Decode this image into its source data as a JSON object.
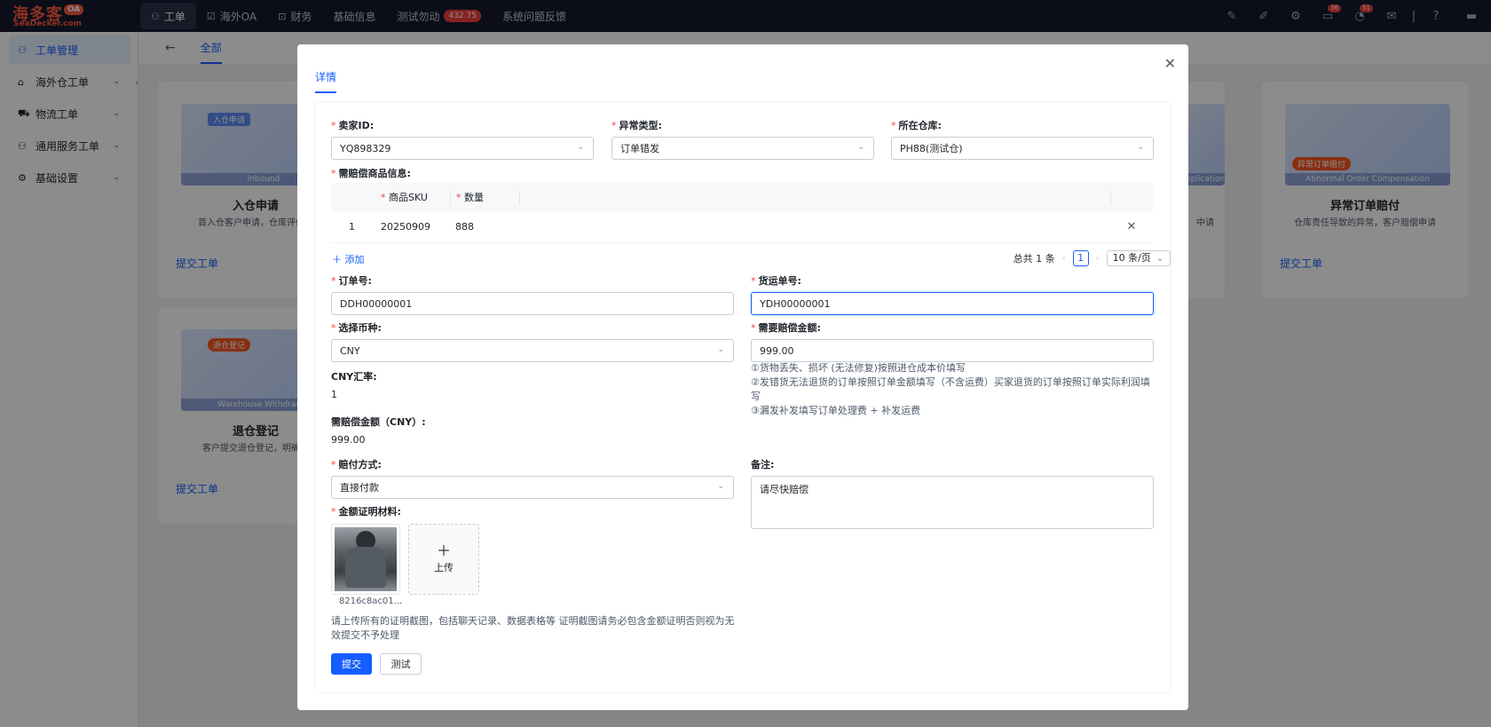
{
  "logo": {
    "line1": "海多客",
    "line2": "SeaDecker.com",
    "badge": "OA"
  },
  "nav": [
    {
      "label": "工单",
      "icon": "workflow-icon",
      "active": true
    },
    {
      "label": "海外OA",
      "icon": "checkbox-icon"
    },
    {
      "label": "财务",
      "icon": "finance-icon"
    },
    {
      "label": "基础信息"
    },
    {
      "label": "测试勿动",
      "badge": "432.75"
    },
    {
      "label": "系统问题反馈"
    }
  ],
  "topbar_badges": {
    "cart": "36",
    "bell": "51"
  },
  "sidebar": {
    "items": [
      {
        "label": "工单管理",
        "active": true
      },
      {
        "label": "海外仓工单"
      },
      {
        "label": "物流工单"
      },
      {
        "label": "通用服务工单"
      },
      {
        "label": "基础设置"
      }
    ]
  },
  "main": {
    "tab_all": "全部"
  },
  "cards": [
    {
      "title": "入仓申请",
      "desc": "首入仓客户申请，仓库评估…",
      "link": "提交工单",
      "tag": "入仓申请",
      "caption": "Inbound"
    },
    {
      "title": "退仓登记",
      "desc": "客户提交退仓登记，明确…",
      "link": "提交工单",
      "tag": "退仓登记",
      "caption": "Warehouse Withdrawal"
    },
    {
      "title": "",
      "desc": "中请",
      "link": "",
      "tag": "",
      "caption": "pplication"
    },
    {
      "title": "异常订单赔付",
      "desc": "仓库责任导致的异常，客户赔偿申请",
      "link": "提交工单",
      "tag": "异常订单赔付",
      "caption": "Abnormal Order Compensation"
    }
  ],
  "modal": {
    "tab": "详情",
    "seller": {
      "label": "卖家ID:",
      "value": "YQ898329"
    },
    "abnormal_type": {
      "label": "异常类型:",
      "value": "订单错发"
    },
    "warehouse": {
      "label": "所在仓库:",
      "value": "PH88(测试仓)"
    },
    "goods_info_label": "需赔偿商品信息:",
    "sku_table": {
      "headers": [
        "商品SKU",
        "数量"
      ],
      "rows": [
        {
          "index": "1",
          "sku": "20250909",
          "qty": "888"
        }
      ]
    },
    "add_label": "添加",
    "pager": {
      "total": "总共 1 条",
      "page": "1",
      "size": "10 条/页"
    },
    "order_no": {
      "label": "订单号:",
      "value": "DDH00000001"
    },
    "tracking_no": {
      "label": "货运单号:",
      "value": "YDH00000001"
    },
    "currency": {
      "label": "选择币种:",
      "value": "CNY"
    },
    "amount": {
      "label": "需要赔偿金额:",
      "value": "999.00"
    },
    "amount_hints": [
      "①货物丢失、损坏 (无法修复)按照进仓成本价填写",
      "②发错货无法退货的订单按照订单金额填写（不含运费）买家退货的订单按照订单实际利润填写",
      "③漏发补发填写订单处理费 + 补发运费"
    ],
    "rate": {
      "label": "CNY汇率:",
      "value": "1"
    },
    "amount_cny": {
      "label": "需赔偿金额（CNY）:",
      "value": "999.00"
    },
    "pay_method": {
      "label": "赔付方式:",
      "value": "直接付款"
    },
    "remark": {
      "label": "备注:",
      "value": "请尽快赔偿"
    },
    "proof": {
      "label": "金额证明材料:",
      "file_name": "8216c8ac01...",
      "upload_label": "上传"
    },
    "proof_hint": "请上传所有的证明截图，包括聊天记录、数据表格等 证明截图请务必包含金额证明否则视为无效提交不予处理",
    "submit_label": "提交",
    "test_label": "测试"
  }
}
